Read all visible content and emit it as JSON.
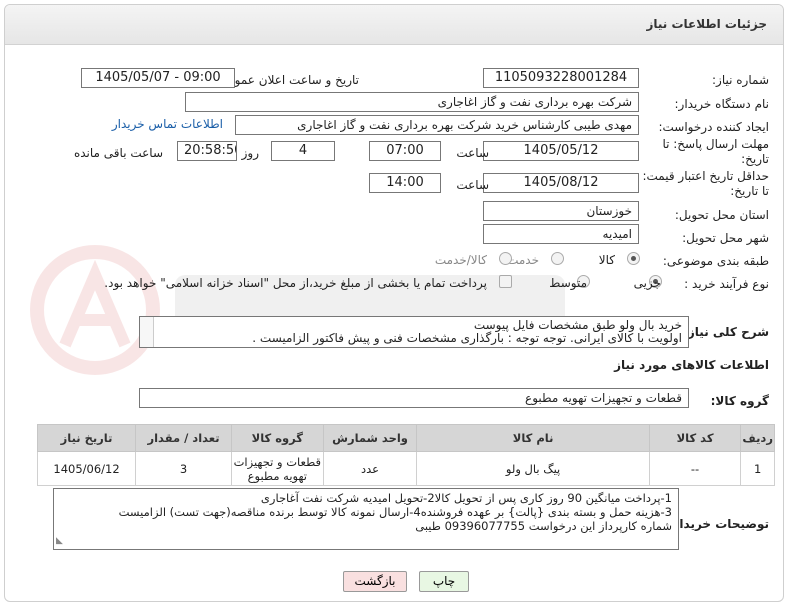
{
  "header": {
    "title": "جزئیات اطلاعات نیاز"
  },
  "fields": {
    "need_number": {
      "label": "شماره نیاز:",
      "value": "1105093228001284"
    },
    "announce_datetime": {
      "label": "تاریخ و ساعت اعلان عمومی:",
      "value": "1405/05/07 - 09:00"
    },
    "buyer_org": {
      "label": "نام دستگاه خریدار:",
      "value": "شرکت بهره برداری نفت و گاز اغاجاری"
    },
    "requester": {
      "label": "ایجاد کننده درخواست:",
      "value": "مهدی طیبی کارشناس خرید شرکت بهره برداری نفت و گاز اغاجاری",
      "contact_link": "اطلاعات تماس خریدار"
    },
    "reply_deadline": {
      "label_1": "مهلت ارسال پاسخ: تا",
      "label_2": "تاریخ:",
      "date": "1405/05/12",
      "time_label": "ساعت",
      "time": "07:00",
      "days": "4",
      "days_label": "روز و",
      "remaining": "20:58:50",
      "remaining_label": "ساعت باقی مانده"
    },
    "price_validity": {
      "label_1": "حداقل تاریخ اعتبار قیمت:",
      "label_2": "تا تاریخ:",
      "date": "1405/08/12",
      "time_label": "ساعت",
      "time": "14:00"
    },
    "province": {
      "label": "استان محل تحویل:",
      "value": "خوزستان"
    },
    "city": {
      "label": "شهر محل تحویل:",
      "value": "امیدیه"
    },
    "category": {
      "label": "طبقه بندی موضوعی:",
      "options": [
        "کالا",
        "خدمت",
        "کالا/خدمت"
      ],
      "selected": "کالا"
    },
    "process": {
      "label": "نوع فرآیند خرید :",
      "options": [
        "جزیی",
        "متوسط"
      ],
      "selected": "جزیی",
      "payment_note": "پرداخت تمام یا بخشی از مبلغ خرید،از محل \"اسناد خزانه اسلامی\" خواهد بود."
    }
  },
  "summary": {
    "label": "شرح کلی نیاز:",
    "line1": "خرید بال ولو طبق مشخصات فایل پیوست",
    "line2": "اولویت با کالای ایرانی. توجه توجه : بارگذاری مشخصات فنی و پیش فاکتور الزامیست ."
  },
  "goods_section": {
    "title": "اطلاعات کالاهای مورد نیاز",
    "group_label": "گروه کالا:",
    "group_value": "قطعات و تجهیزات تهویه مطبوع"
  },
  "table": {
    "headers": [
      "ردیف",
      "کد کالا",
      "نام کالا",
      "واحد شمارش",
      "گروه کالا",
      "تعداد / مقدار",
      "تاریخ نیاز"
    ],
    "rows": [
      [
        "1",
        "--",
        "پیگ بال ولو",
        "عدد",
        "قطعات و تجهیزات تهویه مطبوع",
        "3",
        "1405/06/12"
      ]
    ]
  },
  "buyer_notes": {
    "label": "توضیحات خریدار:",
    "line1": "1-پرداخت میانگین 90 روز کاری پس از تحویل کالا2-تحویل امیدیه شرکت نفت آغاجاری",
    "line2": "3-هزینه حمل  و بسته بندی {پالت} بر عهده فروشنده4-ارسال نمونه کالا توسط برنده مناقصه(جهت تست) الزامیست",
    "line3": "شماره کارپرداز این درخواست 09396077755 طیبی"
  },
  "buttons": {
    "print": "چاپ",
    "back": "بازگشت"
  },
  "colors": {
    "print_bg": "#e8f7e3",
    "back_bg": "#f9e0e0",
    "link": "#1a5ea8",
    "table_header": "#d6d6d6"
  }
}
